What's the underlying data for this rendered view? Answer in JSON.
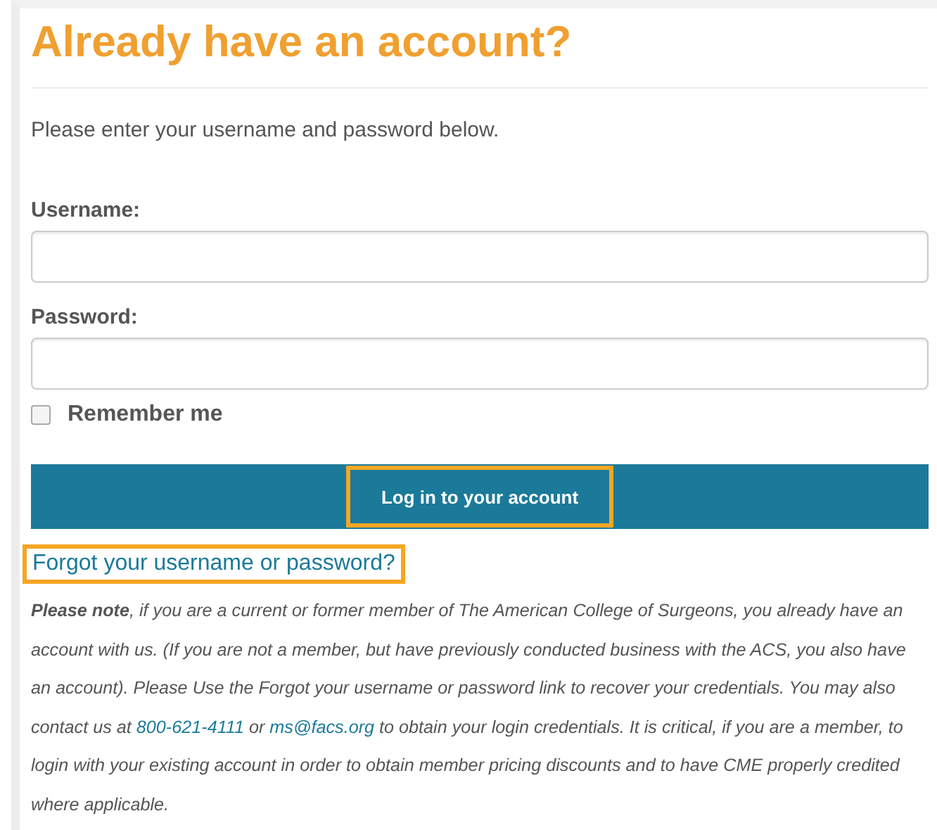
{
  "heading": "Already have an account?",
  "intro": "Please enter your username and password below.",
  "fields": [
    {
      "label": "Username:"
    },
    {
      "label": "Password:"
    }
  ],
  "remember": {
    "label": "Remember me",
    "checked": false
  },
  "login_button": {
    "label": "Log in to your account",
    "highlighted": true
  },
  "forgot_link": {
    "label": "Forgot your username or password?",
    "highlighted": true
  },
  "note": [
    {
      "kind": "text",
      "text": "**Please note**, if you are a current or former member of The American College of Surgeons, you already have an account with us. (If you are not a member, but have previously conducted business with the ACS, you also have an account). Please Use the Forgot your username or password link to recover your credentials. You may also contact us at "
    },
    {
      "kind": "link",
      "text": "800-621-4111"
    },
    {
      "kind": "text",
      "text": " or "
    },
    {
      "kind": "link",
      "text": "ms@facs.org"
    },
    {
      "kind": "text",
      "text": " to obtain your login credentials. It is critical, if you are a member, to login with your existing account in order to obtain member pricing discounts and to have CME properly credited where applicable."
    }
  ]
}
